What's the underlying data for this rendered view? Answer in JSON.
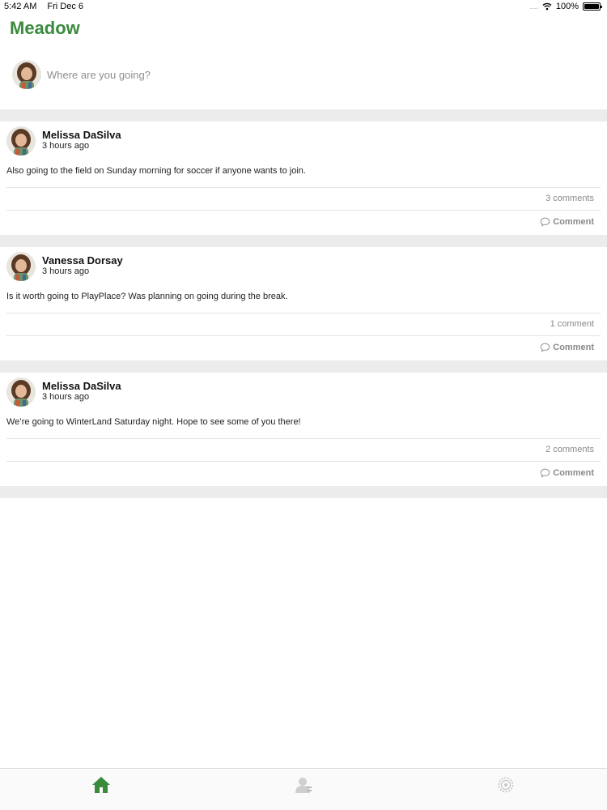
{
  "status_bar": {
    "time": "5:42 AM",
    "date": "Fri Dec 6",
    "signal": "....",
    "battery": "100%",
    "battery_level": 1.0
  },
  "app": {
    "title": "Meadow",
    "accent_color": "#3a8a3e"
  },
  "composer": {
    "placeholder": "Where are you going?"
  },
  "posts": [
    {
      "author": "Melissa DaSilva",
      "time": "3 hours ago",
      "body": "Also going to the field on Sunday morning for soccer if anyone wants to join.",
      "comment_count": "3 comments",
      "comment_label": "Comment"
    },
    {
      "author": "Vanessa Dorsay",
      "time": "3 hours ago",
      "body": "Is it worth going to PlayPlace? Was planning on going during the break.",
      "comment_count": "1 comment",
      "comment_label": "Comment"
    },
    {
      "author": "Melissa DaSilva",
      "time": "3 hours ago",
      "body": "We’re going to WinterLand Saturday night. Hope to see some of you there!",
      "comment_count": "2 comments",
      "comment_label": "Comment"
    }
  ],
  "tab_bar": {
    "tabs": [
      {
        "icon": "home-icon",
        "active": true
      },
      {
        "icon": "contacts-icon",
        "active": false
      },
      {
        "icon": "settings-icon",
        "active": false
      }
    ]
  }
}
